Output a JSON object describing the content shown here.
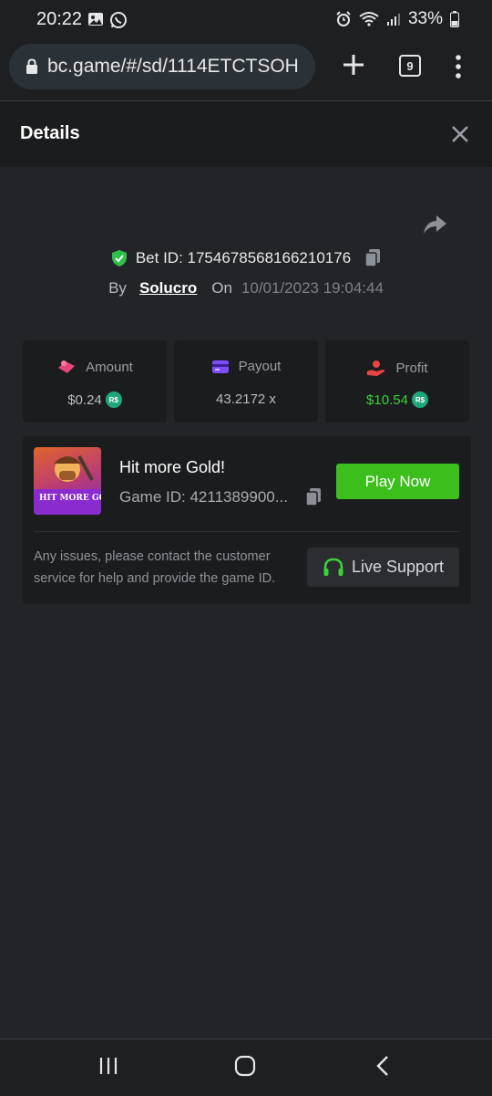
{
  "status_bar": {
    "time": "20:22",
    "battery": "33%"
  },
  "browser": {
    "url": "bc.game/#/sd/1114ETCTSOH",
    "tab_count": "9"
  },
  "header": {
    "title": "Details"
  },
  "bet": {
    "id_label": "Bet ID: 1754678568166210176",
    "by_label": "By",
    "username": "Solucro",
    "on_label": "On",
    "datetime": "10/01/2023 19:04:44"
  },
  "stats": {
    "amount": {
      "label": "Amount",
      "value": "$0.24",
      "currency": "R$"
    },
    "payout": {
      "label": "Payout",
      "value": "43.2172 x"
    },
    "profit": {
      "label": "Profit",
      "value": "$10.54",
      "currency": "R$"
    }
  },
  "game": {
    "title": "Hit more Gold!",
    "thumb_text": "HIT MORE GOLD!",
    "id_label": "Game ID: 4211389900...",
    "play_label": "Play Now"
  },
  "support": {
    "message": "Any issues, please contact the customer service for help and provide the game ID.",
    "button_label": "Live Support"
  },
  "colors": {
    "accent_green": "#3cbf1d",
    "profit_green": "#3ad13a",
    "coin_teal": "#1fa67a",
    "background": "#232427"
  }
}
